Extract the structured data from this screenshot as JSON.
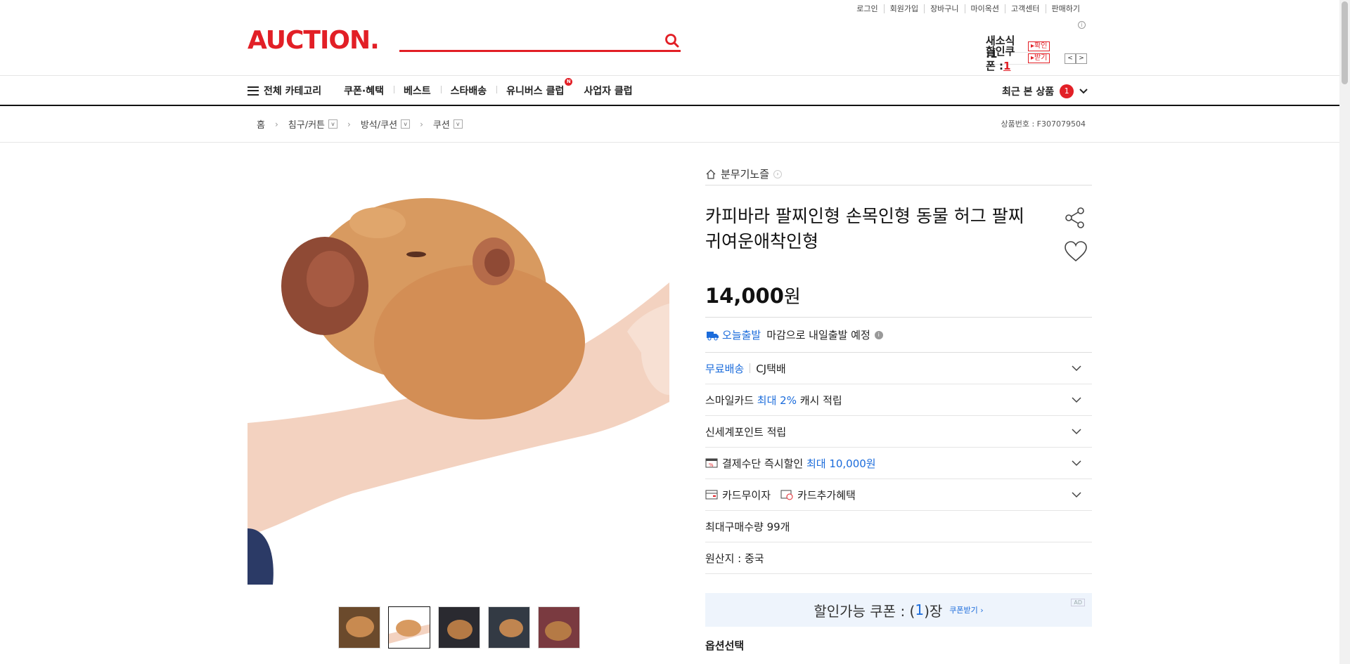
{
  "util_links": [
    "로그인",
    "회원가입",
    "장바구니",
    "마이옥션",
    "고객센터",
    "판매하기"
  ],
  "logo": "AUCTION.",
  "mini": {
    "news_label": "새소식 :",
    "news_count": "1",
    "news_btn": "확인",
    "coupon_label": "할인쿠폰 :",
    "coupon_count": "1",
    "coupon_btn": "받기"
  },
  "gnb": {
    "all_categories": "전체 카테고리",
    "items": [
      "쿠폰·혜택",
      "베스트",
      "스타배송",
      "유니버스 클럽",
      "사업자 클럽"
    ],
    "new_badge": "N",
    "recent_label": "최근 본 상품",
    "recent_count": "1"
  },
  "breadcrumb": {
    "items": [
      "홈",
      "침구/커튼",
      "방석/쿠션",
      "쿠션"
    ],
    "product_no": "상품번호 : F307079504"
  },
  "product": {
    "store": "분무기노즐",
    "title": "카피바라 팔찌인형 손목인형 동물 허그 팔찌 귀여운애착인형",
    "price": "14,000",
    "currency": "원",
    "today_label": "오늘출발",
    "today_text": "마감으로 내일출발 예정",
    "shipping_free": "무료배송",
    "shipping_carrier": "CJ택배",
    "smile_pre": "스마일카드",
    "smile_blue": "최대 2%",
    "smile_post": "캐시 적립",
    "shinsegae": "신세계포인트 적립",
    "pay_pre": "결제수단 즉시할인",
    "pay_blue": "최대 10,000원",
    "card_interest": "카드무이자",
    "card_extra": "카드추가혜택",
    "max_qty": "최대구매수량 99개",
    "origin": "원산지 : 중국",
    "coupon_pre": "할인가능 쿠폰 : (",
    "coupon_num": "1",
    "coupon_post": ")장",
    "coupon_get": "쿠폰받기 ›",
    "ad": "AD",
    "option_label": "옵션선택"
  },
  "colors": {
    "brand": "#e21f26",
    "blue": "#1a6bdb"
  }
}
